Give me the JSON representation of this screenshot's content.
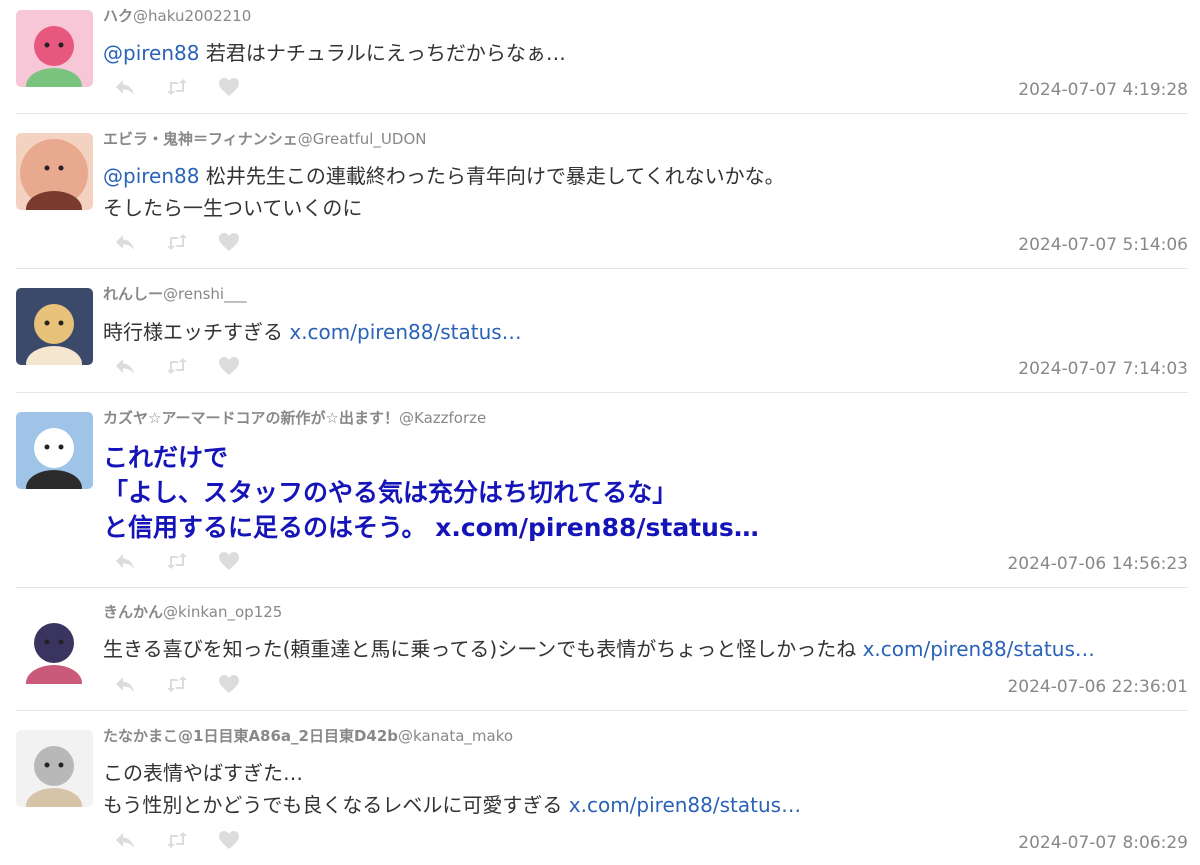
{
  "tweets": [
    {
      "name": "ハク",
      "handle": "@haku2002210",
      "lines": [
        [
          {
            "t": "mention",
            "s": "@piren88"
          },
          {
            "t": "text",
            "s": " 若君はナチュラルにえっちだからなぁ…"
          }
        ]
      ],
      "time": "2024-07-07 4:19:28",
      "avatar_colors": [
        "#f7c7d8",
        "#e8577e",
        "#7bc47f"
      ]
    },
    {
      "name": "エビラ・鬼神＝フィナンシェ",
      "handle": "@Greatful_UDON",
      "lines": [
        [
          {
            "t": "mention",
            "s": "@piren88"
          },
          {
            "t": "text",
            "s": " 松井先生この連載終わったら青年向けで暴走してくれないかな。"
          }
        ],
        [
          {
            "t": "text",
            "s": "そしたら一生ついていくのに"
          }
        ]
      ],
      "time": "2024-07-07 5:14:06",
      "avatar_colors": [
        "#f3d2c1",
        "#e9a98f",
        "#7a3b2e"
      ]
    },
    {
      "name": "れんしー",
      "handle": "@renshi___",
      "lines": [
        [
          {
            "t": "text",
            "s": "時行様エッチすぎる "
          },
          {
            "t": "link",
            "s": "x.com/piren88/status…"
          }
        ]
      ],
      "time": "2024-07-07 7:14:03",
      "avatar_colors": [
        "#3b4a6b",
        "#e8c27a",
        "#f5e6d0"
      ]
    },
    {
      "name": "カズヤ☆アーマードコアの新作が☆出ます！",
      "handle": "@Kazzforze",
      "big": true,
      "lines": [
        [
          {
            "t": "text",
            "s": "これだけで"
          }
        ],
        [
          {
            "t": "text",
            "s": "「よし、スタッフのやる気は充分はち切れてるな」"
          }
        ],
        [
          {
            "t": "text",
            "s": "と信用するに足るのはそう。 "
          },
          {
            "t": "link",
            "s": "x.com/piren88/status…"
          }
        ]
      ],
      "time": "2024-07-06 14:56:23",
      "avatar_colors": [
        "#9fc4e8",
        "#ffffff",
        "#2b2b2b"
      ]
    },
    {
      "name": "きんかん",
      "handle": "@kinkan_op125",
      "lines": [
        [
          {
            "t": "text",
            "s": "生きる喜びを知った(頼重達と馬に乗ってる)シーンでも表情がちょっと怪しかったね "
          },
          {
            "t": "link",
            "s": "x.com/piren88/status…"
          }
        ]
      ],
      "time": "2024-07-06 22:36:01",
      "avatar_colors": [
        "#ffffff",
        "#3a3560",
        "#c95a7a"
      ]
    },
    {
      "name": "たなかまこ@1日目東A86a_2日目東D42b",
      "handle": "@kanata_mako",
      "lines": [
        [
          {
            "t": "text",
            "s": "この表情やばすぎた…"
          }
        ],
        [
          {
            "t": "text",
            "s": "もう性別とかどうでも良くなるレベルに可愛すぎる "
          },
          {
            "t": "link",
            "s": "x.com/piren88/status…"
          }
        ]
      ],
      "time": "2024-07-07 8:06:29",
      "avatar_colors": [
        "#f2f2f2",
        "#b8b8b8",
        "#d6c4a8"
      ]
    }
  ],
  "icons": {
    "reply": "reply-icon",
    "retweet": "retweet-icon",
    "like": "heart-icon"
  },
  "colors": {
    "link": "#2a62b8",
    "meta": "#888888",
    "text": "#333333",
    "divider": "#e6e6e6",
    "action_icon": "#dcdcdc"
  }
}
